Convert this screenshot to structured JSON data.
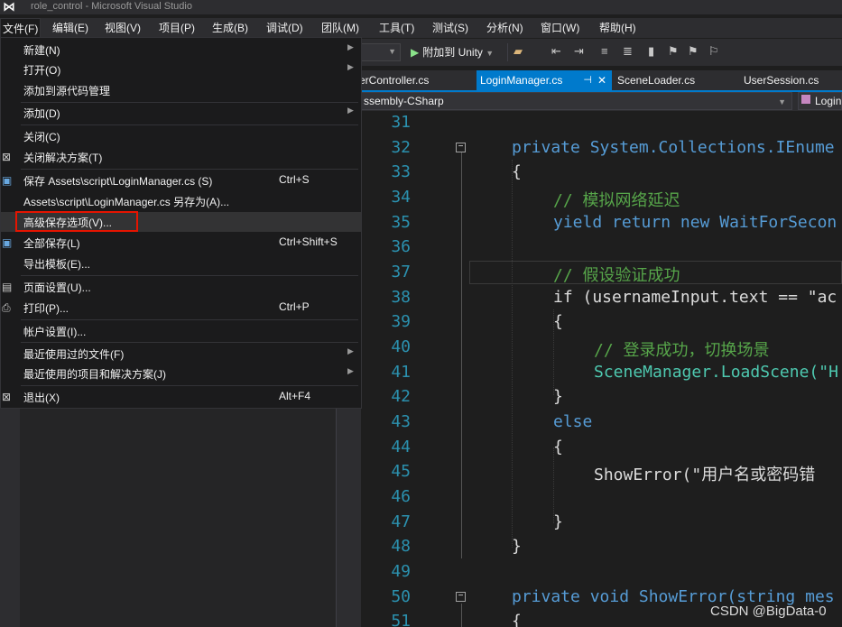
{
  "window": {
    "title": "role_control - Microsoft Visual Studio"
  },
  "menubar": [
    {
      "label": "文件(F)"
    },
    {
      "label": "编辑(E)"
    },
    {
      "label": "视图(V)"
    },
    {
      "label": "项目(P)"
    },
    {
      "label": "生成(B)"
    },
    {
      "label": "调试(D)"
    },
    {
      "label": "团队(M)"
    },
    {
      "label": "工具(T)"
    },
    {
      "label": "测试(S)"
    },
    {
      "label": "分析(N)"
    },
    {
      "label": "窗口(W)"
    },
    {
      "label": "帮助(H)"
    }
  ],
  "toolbar": {
    "attach_label": "附加到 Unity"
  },
  "tabs": [
    {
      "label": "erController.cs"
    },
    {
      "label": "LoginManager.cs",
      "active": true
    },
    {
      "label": "SceneLoader.cs"
    },
    {
      "label": "UserSession.cs"
    }
  ],
  "navbar": {
    "project": "ssembly-CSharp",
    "member": "Login"
  },
  "file_menu": [
    {
      "label": "新建(N)",
      "submenu": true,
      "icon": ""
    },
    {
      "label": "打开(O)",
      "submenu": true,
      "icon": ""
    },
    {
      "label": "添加到源代码管理",
      "icon": ""
    },
    {
      "label": "添加(D)",
      "submenu": true,
      "icon": ""
    },
    {
      "label": "关闭(C)",
      "icon": ""
    },
    {
      "label": "关闭解决方案(T)",
      "icon": "close-solution-icon"
    },
    {
      "label": "保存 Assets\\script\\LoginManager.cs (S)",
      "shortcut": "Ctrl+S",
      "icon": "save-icon"
    },
    {
      "label": "Assets\\script\\LoginManager.cs 另存为(A)...",
      "icon": ""
    },
    {
      "label": "高级保存选项(V)...",
      "icon": "",
      "highlighted": true
    },
    {
      "label": "全部保存(L)",
      "shortcut": "Ctrl+Shift+S",
      "icon": "save-all-icon"
    },
    {
      "label": "导出模板(E)...",
      "icon": ""
    },
    {
      "label": "页面设置(U)...",
      "icon": "page-setup-icon"
    },
    {
      "label": "打印(P)...",
      "shortcut": "Ctrl+P",
      "icon": "print-icon"
    },
    {
      "label": "帐户设置(I)...",
      "icon": ""
    },
    {
      "label": "最近使用过的文件(F)",
      "submenu": true,
      "icon": ""
    },
    {
      "label": "最近使用的项目和解决方案(J)",
      "submenu": true,
      "icon": ""
    },
    {
      "label": "退出(X)",
      "shortcut": "Alt+F4",
      "icon": "exit-icon"
    }
  ],
  "code": [
    {
      "n": "31",
      "text": ""
    },
    {
      "n": "32",
      "text": "private System.Collections.IEnume"
    },
    {
      "n": "33",
      "text": "{"
    },
    {
      "n": "34",
      "text": "// 模拟网络延迟"
    },
    {
      "n": "35",
      "text": "yield return new WaitForSecon"
    },
    {
      "n": "36",
      "text": ""
    },
    {
      "n": "37",
      "text": "// 假设验证成功"
    },
    {
      "n": "38",
      "text": "if (usernameInput.text == \"ac"
    },
    {
      "n": "39",
      "text": "{"
    },
    {
      "n": "40",
      "text": "// 登录成功，切换场景"
    },
    {
      "n": "41",
      "text": "SceneManager.LoadScene(\"H"
    },
    {
      "n": "42",
      "text": "}"
    },
    {
      "n": "43",
      "text": "else"
    },
    {
      "n": "44",
      "text": "{"
    },
    {
      "n": "45",
      "text": "ShowError(\"用户名或密码错"
    },
    {
      "n": "46",
      "text": ""
    },
    {
      "n": "47",
      "text": "}"
    },
    {
      "n": "48",
      "text": "}"
    },
    {
      "n": "49",
      "text": ""
    },
    {
      "n": "50",
      "text": "private void ShowError(string mes"
    },
    {
      "n": "51",
      "text": "{"
    }
  ],
  "watermark": "CSDN @BigData-0"
}
